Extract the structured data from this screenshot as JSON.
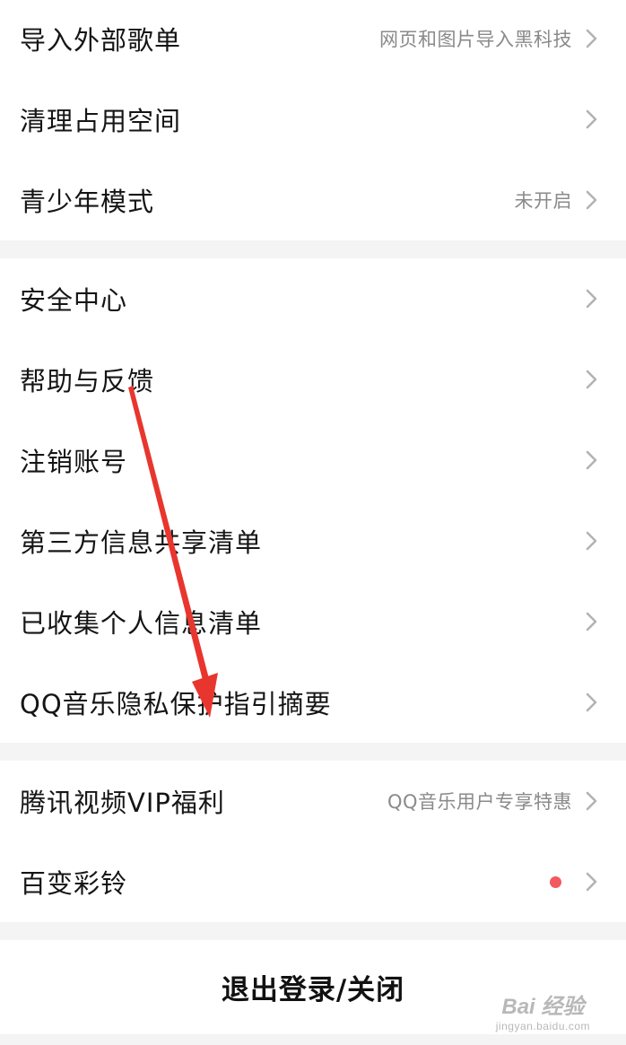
{
  "groups": [
    {
      "items": [
        {
          "title": "导入外部歌单",
          "hint": "网页和图片导入黑科技"
        },
        {
          "title": "清理占用空间"
        },
        {
          "title": "青少年模式",
          "hint": "未开启"
        }
      ]
    },
    {
      "items": [
        {
          "title": "安全中心"
        },
        {
          "title": "帮助与反馈"
        },
        {
          "title": "注销账号"
        },
        {
          "title": "第三方信息共享清单"
        },
        {
          "title": "已收集个人信息清单"
        },
        {
          "title": "QQ音乐隐私保护指引摘要"
        }
      ]
    },
    {
      "items": [
        {
          "title": "腾讯视频VIP福利",
          "hint": "QQ音乐用户专享特惠"
        },
        {
          "title": "百变彩铃",
          "badge": "red-dot"
        }
      ]
    }
  ],
  "logout_label": "退出登录/关闭",
  "watermark": {
    "main": "Bai 经验",
    "sub": "jingyan.baidu.com"
  },
  "colors": {
    "annotation_arrow": "#e8362e",
    "badge_dot": "#f25a5f",
    "hint_text": "#8a8a8a",
    "chevron": "#b3b3b3"
  }
}
